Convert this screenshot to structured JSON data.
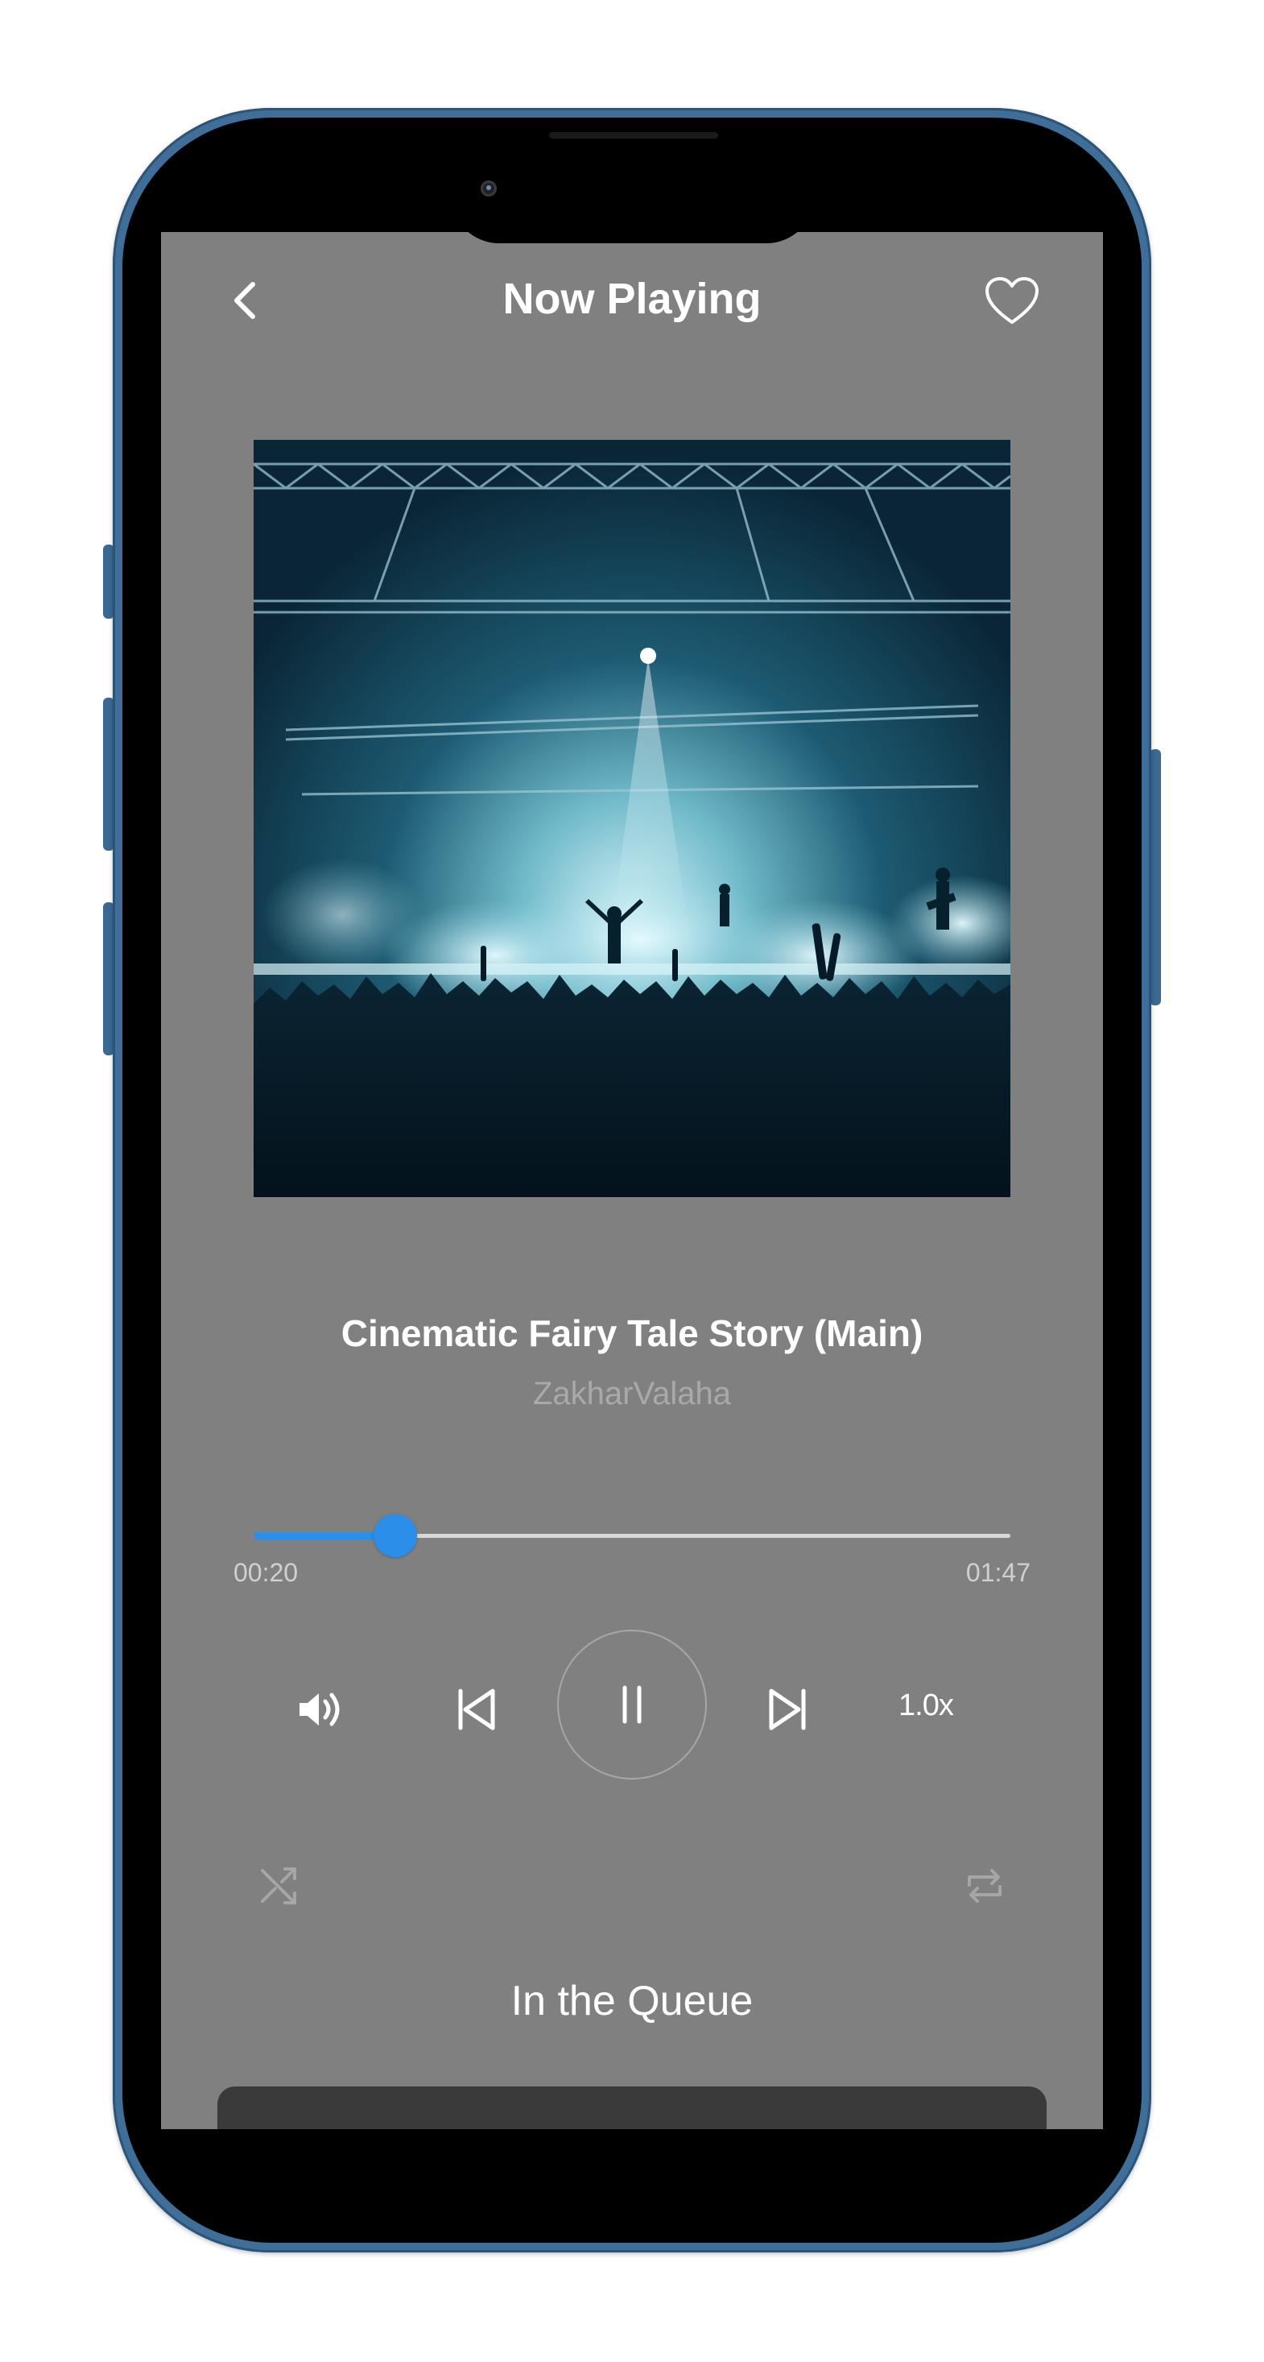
{
  "header": {
    "title": "Now Playing",
    "back_icon": "chevron-left-icon",
    "favorite_icon": "heart-outline-icon"
  },
  "track": {
    "title": "Cinematic Fairy Tale Story (Main)",
    "artist": "ZakharValaha"
  },
  "playback": {
    "elapsed": "00:20",
    "total": "01:47",
    "progress_fraction": 0.187,
    "speed": "1.0x",
    "state": "playing"
  },
  "controls": {
    "volume_icon": "volume-icon",
    "previous_icon": "skip-previous-icon",
    "pause_icon": "pause-icon",
    "next_icon": "skip-next-icon",
    "shuffle_icon": "shuffle-icon",
    "repeat_icon": "repeat-icon"
  },
  "queue": {
    "heading": "In the Queue"
  },
  "colors": {
    "screen_background": "#808080",
    "accent": "#2b8ee8",
    "frame": "#3f6f99"
  }
}
